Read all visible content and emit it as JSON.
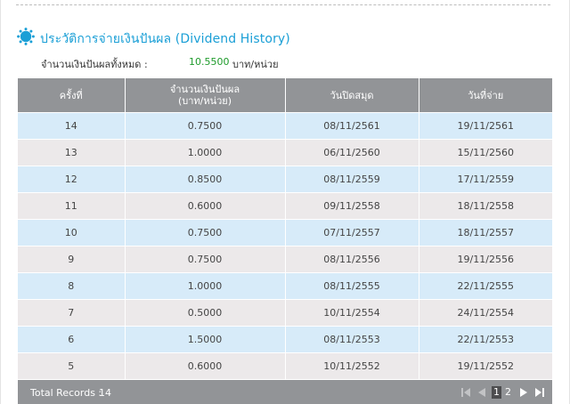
{
  "section": {
    "title": "ประวัติการจ่ายเงินปันผล (Dividend History)",
    "icon": "bullet-burst-icon",
    "accent_color": "#1a9fd6"
  },
  "summary": {
    "label": "จำนวนเงินปันผลทั้งหมด :",
    "value": "10.5500",
    "unit": "บาท/หน่วย"
  },
  "table": {
    "headers": [
      "ครั้งที่",
      "จำนวนเงินปันผล",
      "(บาท/หน่วย)",
      "วันปิดสมุด",
      "วันที่จ่าย"
    ],
    "rows": [
      [
        "14",
        "0.7500",
        "08/11/2561",
        "19/11/2561"
      ],
      [
        "13",
        "1.0000",
        "06/11/2560",
        "15/11/2560"
      ],
      [
        "12",
        "0.8500",
        "08/11/2559",
        "17/11/2559"
      ],
      [
        "11",
        "0.6000",
        "09/11/2558",
        "18/11/2558"
      ],
      [
        "10",
        "0.7500",
        "07/11/2557",
        "18/11/2557"
      ],
      [
        "9",
        "0.7500",
        "08/11/2556",
        "19/11/2556"
      ],
      [
        "8",
        "1.0000",
        "08/11/2555",
        "22/11/2555"
      ],
      [
        "7",
        "0.5000",
        "10/11/2554",
        "24/11/2554"
      ],
      [
        "6",
        "1.5000",
        "08/11/2553",
        "22/11/2553"
      ],
      [
        "5",
        "0.6000",
        "10/11/2552",
        "19/11/2552"
      ]
    ]
  },
  "footer": {
    "total_label": "Total Records :",
    "total_value": "14",
    "pages": [
      "1",
      "2"
    ],
    "current_page": "1"
  }
}
